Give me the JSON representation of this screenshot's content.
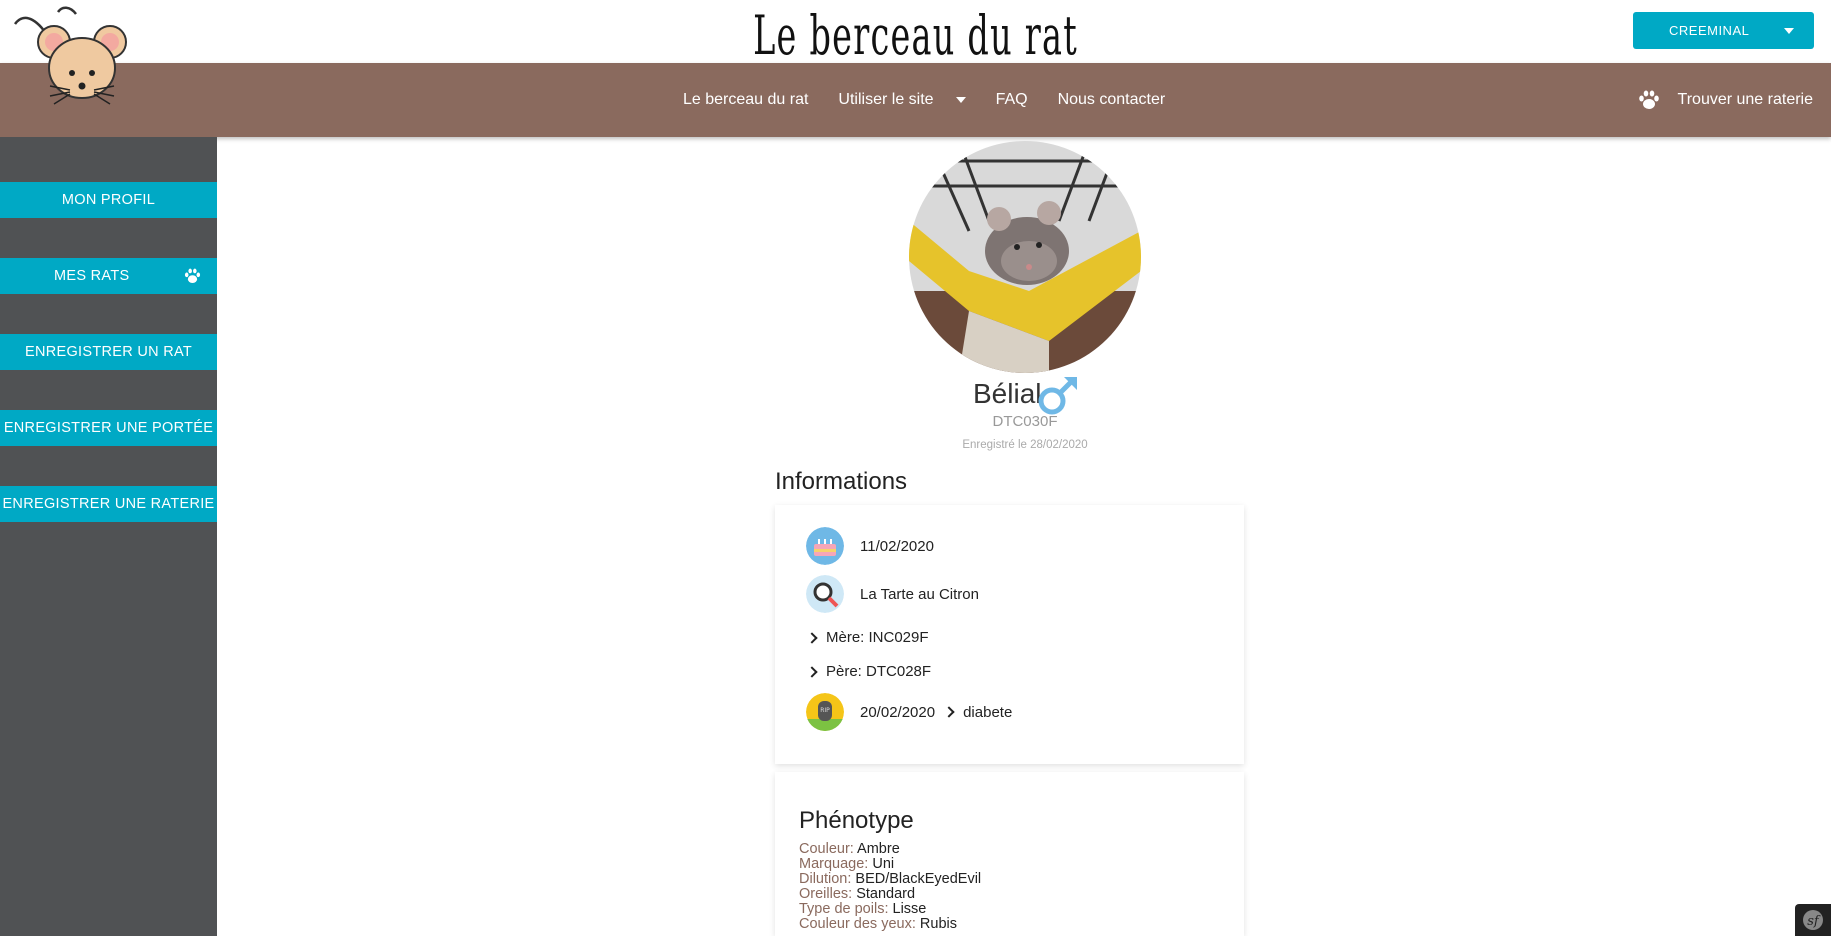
{
  "header": {
    "site_title": "Le berceau du rat",
    "user_menu_label": "CREEMINAL"
  },
  "nav": {
    "links": [
      "Le berceau du rat",
      "Utiliser le site",
      "FAQ",
      "Nous contacter"
    ],
    "find_raterie": "Trouver une raterie"
  },
  "sidebar": {
    "items": [
      "MON PROFIL",
      "MES RATS",
      "ENREGISTRER UN RAT",
      "ENREGISTRER UNE PORTÉE",
      "ENREGISTRER UNE RATERIE"
    ]
  },
  "rat": {
    "name": "Bélial",
    "sex_icon": "male-icon",
    "id": "DTC030F",
    "registered": "Enregistré le 28/02/2020"
  },
  "info": {
    "title": "Informations",
    "birth_date": "11/02/2020",
    "raterie": "La Tarte au Citron",
    "mother": "Mère: INC029F",
    "father": "Père: DTC028F",
    "death_date": "20/02/2020",
    "death_cause": "diabete"
  },
  "phenotype": {
    "title": "Phénotype",
    "rows": [
      {
        "key": "Couleur:",
        "value": "Ambre"
      },
      {
        "key": "Marquage:",
        "value": "Uni"
      },
      {
        "key": "Dilution:",
        "value": "BED/BlackEyedEvil"
      },
      {
        "key": "Oreilles:",
        "value": "Standard"
      },
      {
        "key": "Type de poils:",
        "value": "Lisse"
      },
      {
        "key": "Couleur des yeux:",
        "value": "Rubis"
      }
    ]
  },
  "colors": {
    "accent": "#00a9c5",
    "nav_brown": "#8a6a5e",
    "sidebar_gray": "#505254",
    "male_blue": "#6fb8e6"
  }
}
